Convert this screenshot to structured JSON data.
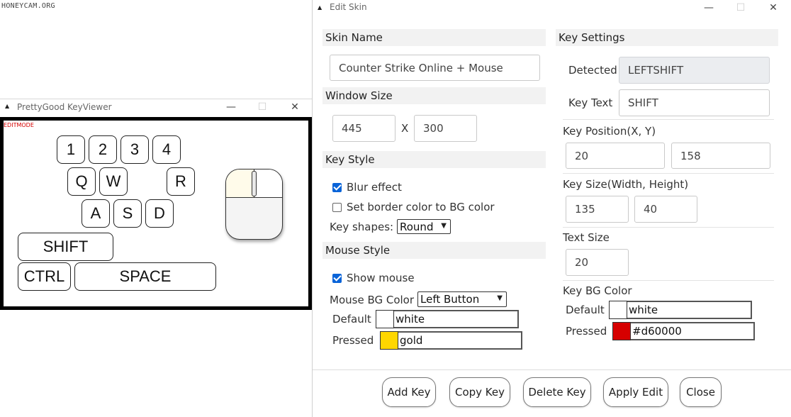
{
  "watermark": "HONEYCAM.ORG",
  "keyviewer": {
    "title": "PrettyGood KeyViewer",
    "editmode": "EDITMODE",
    "keys": {
      "k1": "1",
      "k2": "2",
      "k3": "3",
      "k4": "4",
      "q": "Q",
      "w": "W",
      "r": "R",
      "a": "A",
      "s": "S",
      "d": "D",
      "shift": "SHIFT",
      "ctrl": "CTRL",
      "space": "SPACE"
    },
    "controls": {
      "minimize": "—",
      "maximize": "☐",
      "close": "✕"
    }
  },
  "edit_skin": {
    "title": "Edit Skin",
    "skin_name": {
      "header": "Skin Name",
      "value": "Counter Strike Online + Mouse"
    },
    "window_size": {
      "header": "Window Size",
      "width": "445",
      "separator": "X",
      "height": "300"
    },
    "key_style": {
      "header": "Key Style",
      "blur_effect": {
        "label": "Blur effect",
        "checked": true
      },
      "border_color": {
        "label": "Set border color to BG color",
        "checked": false
      },
      "key_shapes_label": "Key shapes:",
      "key_shapes_value": "Round"
    },
    "mouse_style": {
      "header": "Mouse Style",
      "show_mouse": {
        "label": "Show mouse",
        "checked": true
      },
      "bg_color_label": "Mouse BG Color",
      "bg_color_target": "Left Button",
      "default_label": "Default",
      "default_value": "white",
      "default_swatch": "#ffffff",
      "pressed_label": "Pressed",
      "pressed_value": "gold",
      "pressed_swatch": "#ffd700"
    },
    "key_settings": {
      "header": "Key Settings",
      "detected_label": "Detected",
      "detected_value": "LEFTSHIFT",
      "key_text_label": "Key Text",
      "key_text_value": "SHIFT",
      "position_label": "Key Position(X, Y)",
      "pos_x": "20",
      "pos_y": "158",
      "size_label": "Key Size(Width, Height)",
      "size_w": "135",
      "size_h": "40",
      "text_size_label": "Text Size",
      "text_size_value": "20",
      "bg_color_label": "Key BG Color",
      "default_label": "Default",
      "default_value": "white",
      "default_swatch": "#ffffff",
      "pressed_label": "Pressed",
      "pressed_value": "#d60000",
      "pressed_swatch": "#d60000"
    },
    "buttons": {
      "add_key": "Add Key",
      "copy_key": "Copy Key",
      "delete_key": "Delete Key",
      "apply_edit": "Apply Edit",
      "close": "Close"
    },
    "controls": {
      "minimize": "—",
      "maximize": "☐",
      "close": "✕"
    }
  }
}
